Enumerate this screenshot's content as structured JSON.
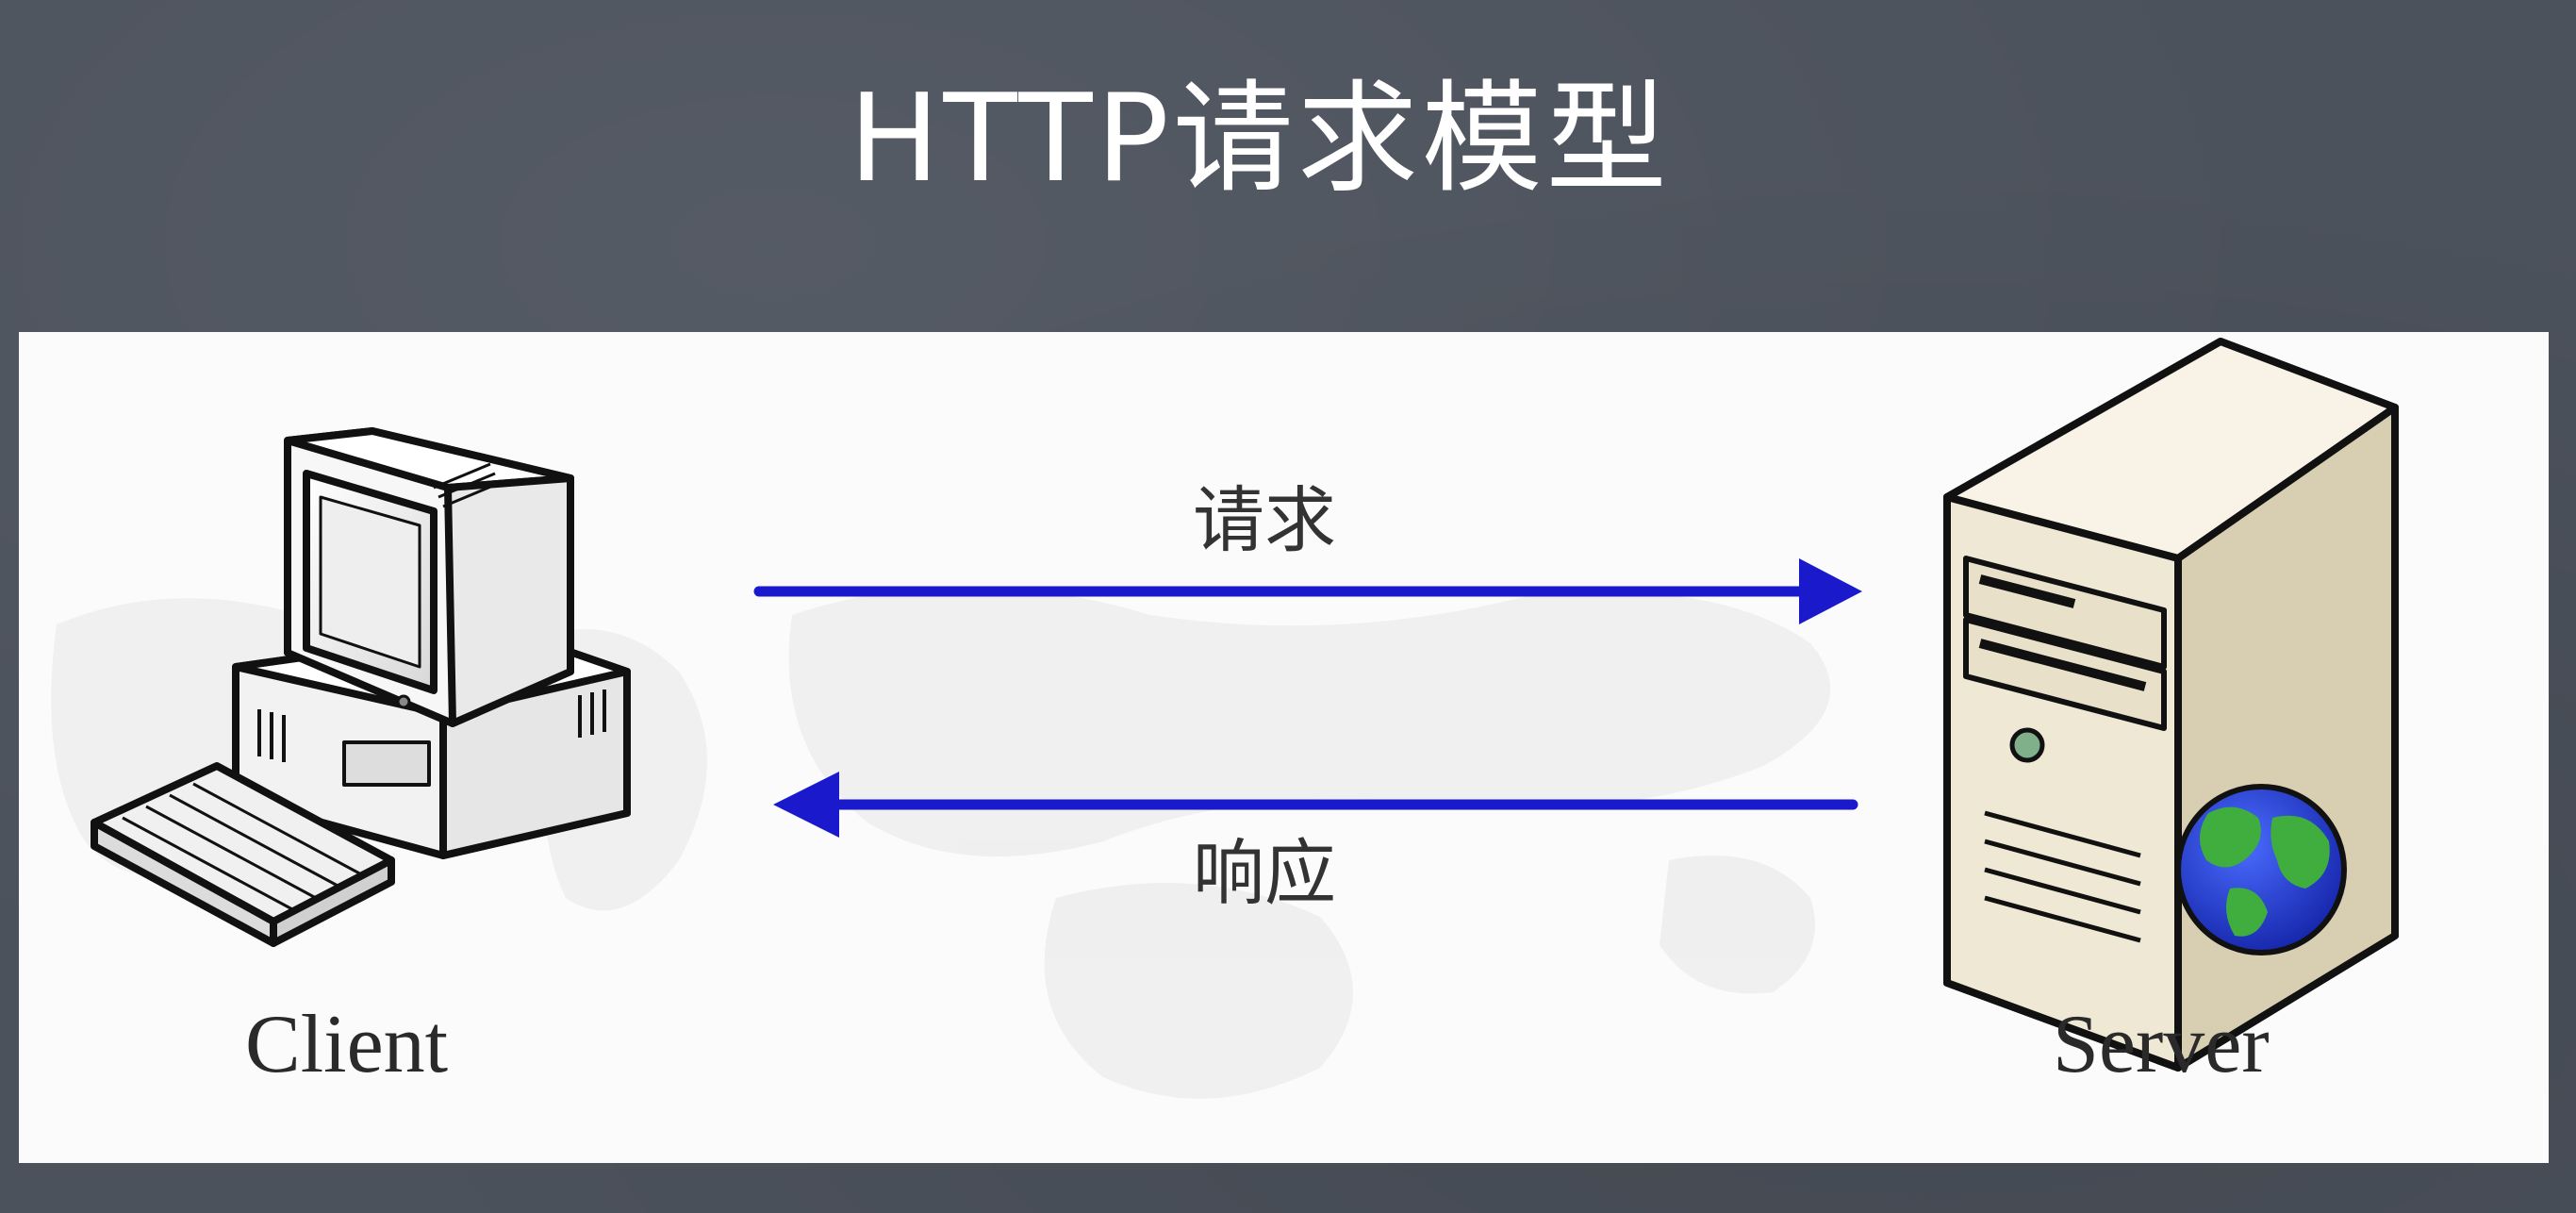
{
  "slide": {
    "title": "HTTP请求模型"
  },
  "diagram": {
    "request_label": "请求",
    "response_label": "响应",
    "client_label": "Client",
    "server_label": "Server",
    "arrow_color": "#1a1acc",
    "nodes": [
      {
        "id": "client",
        "icon": "desktop-computer-icon"
      },
      {
        "id": "server",
        "icon": "server-tower-icon"
      }
    ],
    "edges": [
      {
        "from": "client",
        "to": "server",
        "label": "请求"
      },
      {
        "from": "server",
        "to": "client",
        "label": "响应"
      }
    ]
  },
  "colors": {
    "background": "#4c525c",
    "panel": "#fbfbfb",
    "title_text": "#ffffff",
    "server_body": "#ece4cf",
    "globe_water": "#1f3fd6",
    "globe_land": "#3fae3f"
  }
}
